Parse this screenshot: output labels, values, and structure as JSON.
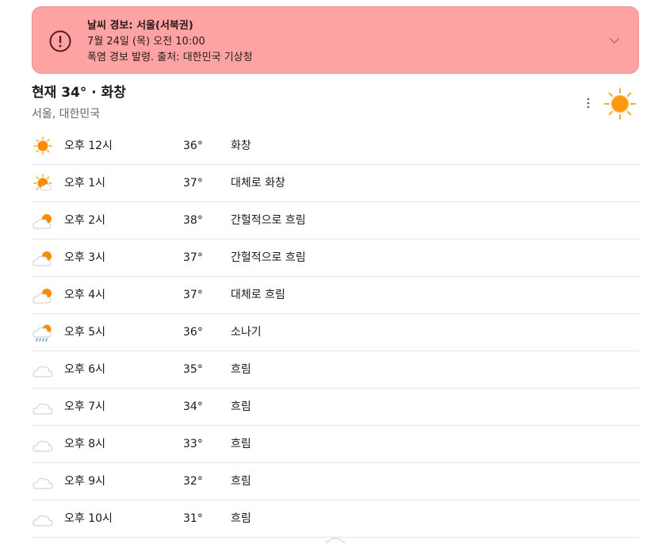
{
  "alert": {
    "title": "날씨 경보: 서울(서북권)",
    "time": "7월 24일 (목) 오전 10:00",
    "description": "폭염 경보 발령. 출처: 대한민국 기상청",
    "icon": "alert-circle-icon",
    "background": "#fda3a3"
  },
  "current": {
    "title": "현재 34° · 화창",
    "location": "서울, 대한민국",
    "icon": "sun-icon"
  },
  "hourly": [
    {
      "time": "오후 12시",
      "temp": "36°",
      "condition": "화창",
      "icon": "sun"
    },
    {
      "time": "오후 1시",
      "temp": "37°",
      "condition": "대체로 화창",
      "icon": "mostly-sunny"
    },
    {
      "time": "오후 2시",
      "temp": "38°",
      "condition": "간헐적으로 흐림",
      "icon": "partly-cloudy"
    },
    {
      "time": "오후 3시",
      "temp": "37°",
      "condition": "간헐적으로 흐림",
      "icon": "partly-cloudy"
    },
    {
      "time": "오후 4시",
      "temp": "37°",
      "condition": "대체로 흐림",
      "icon": "partly-cloudy"
    },
    {
      "time": "오후 5시",
      "temp": "36°",
      "condition": "소나기",
      "icon": "showers"
    },
    {
      "time": "오후 6시",
      "temp": "35°",
      "condition": "흐림",
      "icon": "cloudy"
    },
    {
      "time": "오후 7시",
      "temp": "34°",
      "condition": "흐림",
      "icon": "cloudy"
    },
    {
      "time": "오후 8시",
      "temp": "33°",
      "condition": "흐림",
      "icon": "cloudy"
    },
    {
      "time": "오후 9시",
      "temp": "32°",
      "condition": "흐림",
      "icon": "cloudy"
    },
    {
      "time": "오후 10시",
      "temp": "31°",
      "condition": "흐림",
      "icon": "cloudy"
    }
  ]
}
